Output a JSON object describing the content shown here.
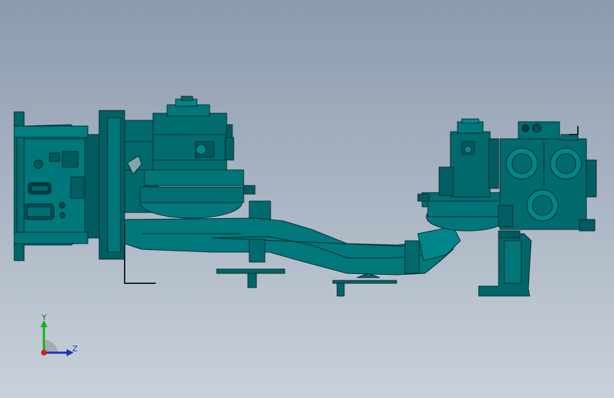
{
  "viewport": {
    "background_top": "#8b9bae",
    "background_bottom": "#c9d1da",
    "model_color": "#00666a",
    "edge_color": "#062a2c"
  },
  "triad": {
    "y_label": "Y",
    "z_label": "Z",
    "y_color": "#12b312",
    "z_color": "#1c2fc4",
    "x_color": "#d81b1b"
  }
}
